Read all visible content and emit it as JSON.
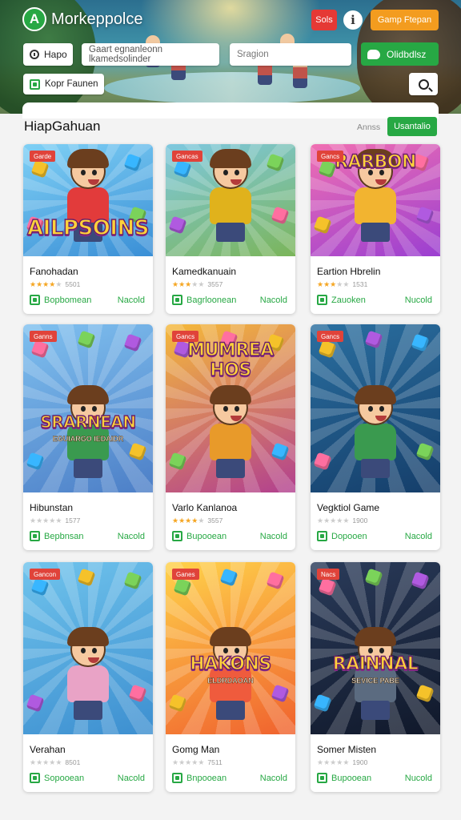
{
  "header": {
    "app_title": "Morkeppolce",
    "logo_letter": "A",
    "red_button": "Sols",
    "orange_button": "Gamp Ftepan",
    "home_chip": "Hapo",
    "search_placeholder": "Gaart egnanleonn lkamedsolinder",
    "search2_placeholder": "Sragion",
    "green_button": "Olidbdlsz",
    "filter_chip": "Kopr Faunen"
  },
  "section": {
    "title": "HiapGahuan",
    "sort_label": "Annss",
    "sort_button": "Usantalio"
  },
  "colors": {
    "accent": "#27a844",
    "badge": "#e0433a",
    "orange": "#f39c1f",
    "red": "#e53935"
  },
  "cards": [
    {
      "badge": "Garde",
      "art_title": "AILPSOINS",
      "art_sub": "",
      "name": "Fanohadan",
      "stars": 4,
      "count": "5501",
      "action": "Bopbomean",
      "price": "Nacold",
      "bg": [
        "#7fd0f5",
        "#3a8fd6"
      ],
      "shirt": "#e23b3b",
      "title_size": 26
    },
    {
      "badge": "Gancas",
      "art_title": "",
      "art_sub": "",
      "name": "Kamedkanuain",
      "stars": 3,
      "count": "3557",
      "action": "Bagrloonean",
      "price": "Nacold",
      "bg": [
        "#7ec8e0",
        "#7bb55a"
      ],
      "shirt": "#e0b21c",
      "title_size": 0
    },
    {
      "badge": "Gancs",
      "art_title": "RARBON",
      "art_sub": "",
      "name": "Eartion Hbrelin",
      "stars": 3,
      "count": "1531",
      "action": "Zauoken",
      "price": "Nucold",
      "bg": [
        "#f06fb2",
        "#9b3fd1"
      ],
      "shirt": "#f2b430",
      "title_size": 22
    },
    {
      "badge": "Ganns",
      "art_title": "SRARNEAN",
      "art_sub": "EGUIARGO IEDAIDR",
      "name": "Hibunstan",
      "stars": 0,
      "count": "1577",
      "action": "Bepbnsan",
      "price": "Nacold",
      "bg": [
        "#7fc0ef",
        "#4d7fc7"
      ],
      "shirt": "#3a9a4f",
      "title_size": 20
    },
    {
      "badge": "Gancs",
      "art_title": "MUMREA HOS",
      "art_sub": "",
      "name": "Varlo Kanlanoa",
      "stars": 4,
      "count": "3557",
      "action": "Bupooean",
      "price": "Nacold",
      "bg": [
        "#f5b93a",
        "#b2408f"
      ],
      "shirt": "#e89a2a",
      "title_size": 22
    },
    {
      "badge": "Gancs",
      "art_title": "",
      "art_sub": "",
      "name": "Vegktiol Game",
      "stars": 0,
      "count": "1900",
      "action": "Dopooen",
      "price": "Nacold",
      "bg": [
        "#2a6fa0",
        "#153e6a"
      ],
      "shirt": "#3a9a4f",
      "title_size": 0
    },
    {
      "badge": "Gancon",
      "art_title": "",
      "art_sub": "",
      "name": "Verahan",
      "stars": 0,
      "count": "8501",
      "action": "Sopooean",
      "price": "Nacold",
      "bg": [
        "#6fc3ec",
        "#3d8fd0"
      ],
      "shirt": "#e9a3c6",
      "title_size": 0
    },
    {
      "badge": "Ganes",
      "art_title": "HAKONS",
      "art_sub": "ELDRDAOAN",
      "name": "Gomg Man",
      "stars": 0,
      "count": "7511",
      "action": "Bnpooean",
      "price": "Nacold",
      "bg": [
        "#ffd24a",
        "#f0622e"
      ],
      "shirt": "#ef5b3d",
      "title_size": 22
    },
    {
      "badge": "Nacs",
      "art_title": "RAINNAL",
      "art_sub": "SEVICE PABE",
      "name": "Somer Misten",
      "stars": 0,
      "count": "1900",
      "action": "Bupooean",
      "price": "Nucold",
      "bg": [
        "#2a3b5a",
        "#10182a"
      ],
      "shirt": "#5b6b80",
      "title_size": 22
    }
  ]
}
